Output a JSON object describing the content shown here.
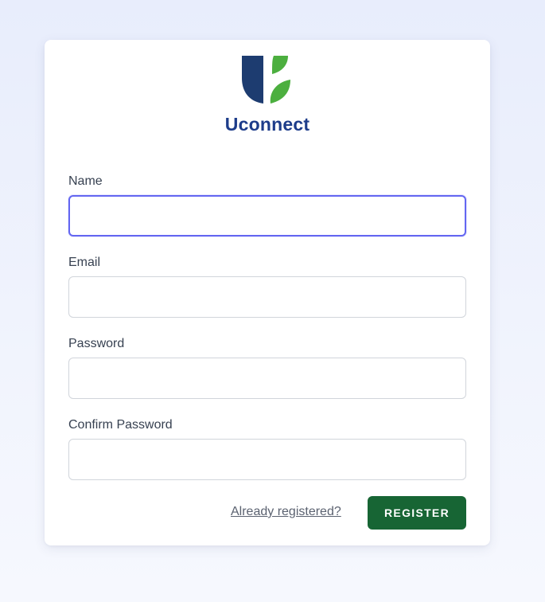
{
  "brand": {
    "name": "Uconnect",
    "logo_icon": "uconnect-shield-leaf-logo",
    "colors": {
      "logo_blue": "#1d3c70",
      "logo_green": "#4caf3f",
      "name_blue": "#1d3c8a"
    }
  },
  "form": {
    "fields": [
      {
        "label": "Name",
        "value": "",
        "focused": true
      },
      {
        "label": "Email",
        "value": "",
        "focused": false
      },
      {
        "label": "Password",
        "value": "",
        "focused": false
      },
      {
        "label": "Confirm Password",
        "value": "",
        "focused": false
      }
    ],
    "login_link_label": "Already registered?",
    "submit_label": "REGISTER",
    "submit_color": "#176534",
    "focus_color": "#6366f1"
  }
}
